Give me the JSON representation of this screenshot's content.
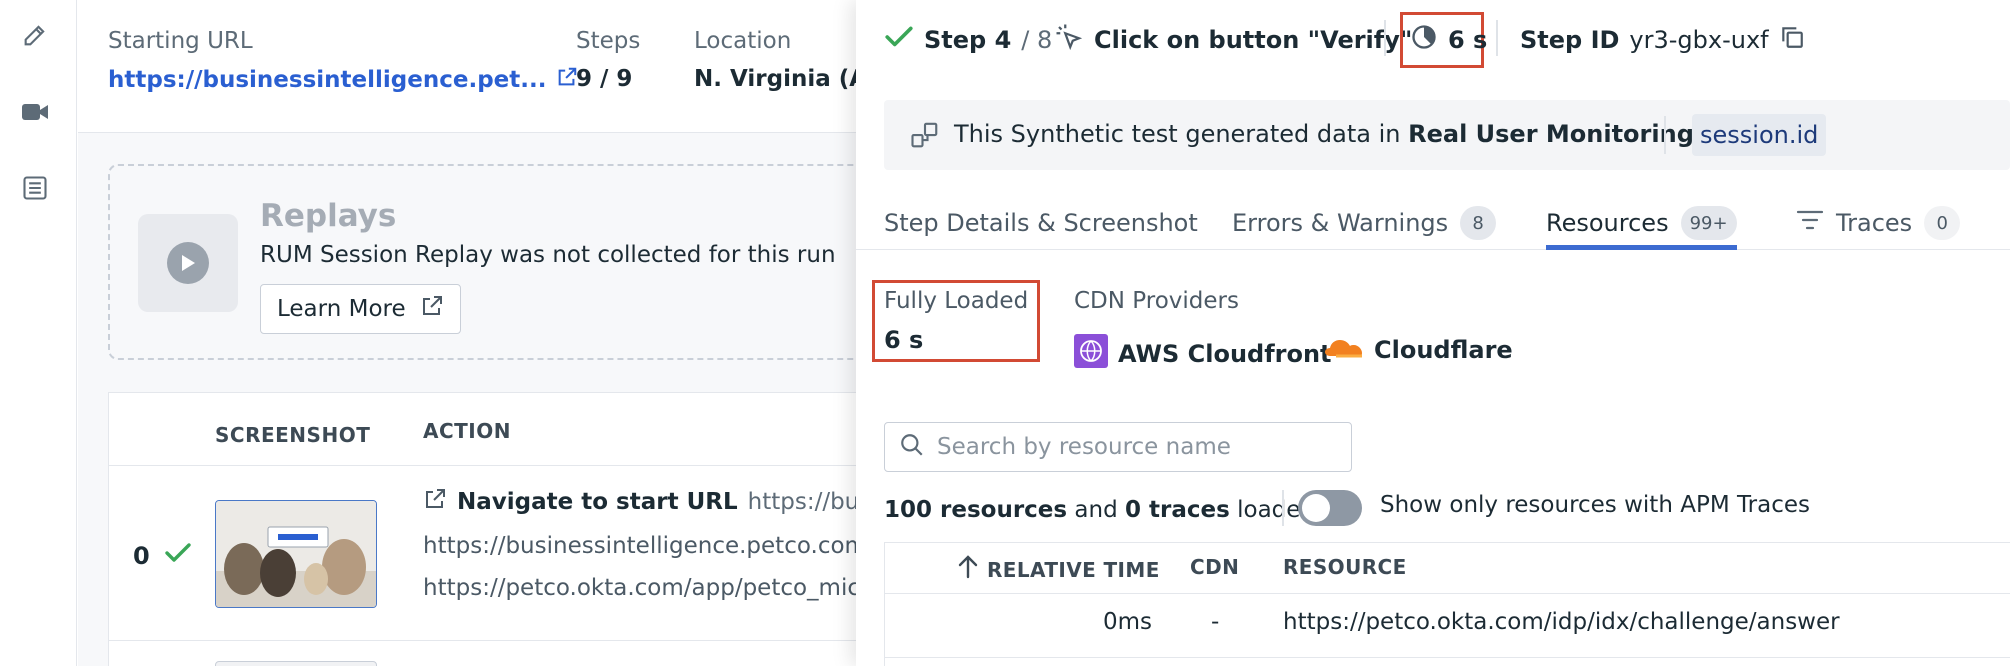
{
  "header": {
    "starting_url_label": "Starting URL",
    "starting_url": "https://businessintelligence.pet...",
    "steps_label": "Steps",
    "steps_value": "9 / 9",
    "location_label": "Location",
    "location_value": "N. Virginia (AWS)"
  },
  "replays": {
    "title": "Replays",
    "message": "RUM Session Replay was not collected for this run",
    "learn_more": "Learn More"
  },
  "steps_table": {
    "columns": [
      "SCREENSHOT",
      "ACTION"
    ],
    "rows": [
      {
        "index": "0",
        "action_title": "Navigate to start URL",
        "action_url": "https://businessintelligence.petco.com/",
        "line1": "https://businessintelligence.petco.com/",
        "line2": "https://petco.okta.com/app/petco_microstrategy"
      }
    ]
  },
  "panel": {
    "step_label": "Step 4",
    "step_total": "/ 8",
    "action": "Click on button \"Verify\"",
    "duration": "6 s",
    "step_id_label": "Step ID",
    "step_id": "yr3-gbx-uxf",
    "banner_text_prefix": "This Synthetic test generated data in ",
    "banner_text_bold": "Real User Monitoring",
    "banner_chip": "session.id",
    "tabs": [
      {
        "label": "Step Details & Screenshot",
        "badge": ""
      },
      {
        "label": "Errors & Warnings",
        "badge": "8"
      },
      {
        "label": "Resources",
        "badge": "99+"
      },
      {
        "label": "Traces",
        "badge": "0"
      }
    ],
    "fully_loaded_label": "Fully Loaded",
    "fully_loaded_value": "6 s",
    "cdn_label": "CDN Providers",
    "cdns": [
      "AWS Cloudfront",
      "Cloudflare"
    ],
    "search_placeholder": "Search by resource name",
    "loaded_summary": {
      "resources": "100 resources",
      "and": " and ",
      "traces": "0 traces",
      "suffix": " loaded"
    },
    "toggle_label": "Show only resources with APM Traces",
    "resource_columns": [
      "RELATIVE TIME",
      "CDN",
      "RESOURCE"
    ],
    "resource_rows": [
      {
        "time": "0ms",
        "cdn": "-",
        "resource": "https://petco.okta.com/idp/idx/challenge/answer"
      }
    ]
  },
  "colors": {
    "accent": "#3c6bd1",
    "link": "#2a5fd1",
    "success": "#3aa657",
    "highlight": "#d24a34"
  },
  "icons": [
    "pencil-icon",
    "video-camera-icon",
    "list-icon",
    "external-link-icon",
    "play-icon",
    "checkmark-icon",
    "cursor-click-icon",
    "pie-timer-icon",
    "copy-icon",
    "synthetics-icon",
    "filter-icon",
    "search-icon",
    "sort-arrow-up-icon"
  ]
}
